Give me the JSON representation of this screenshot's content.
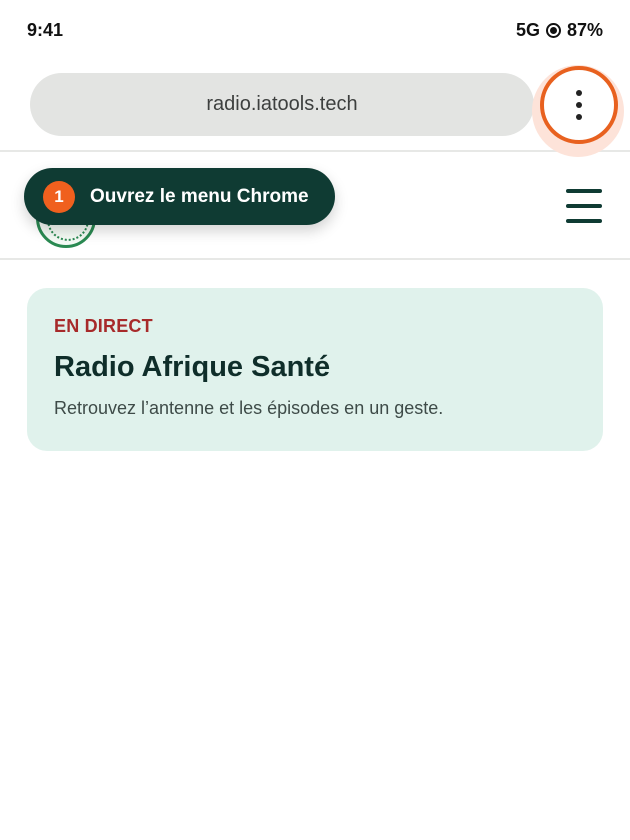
{
  "status_bar": {
    "time": "9:41",
    "network": "5G",
    "battery": "87%"
  },
  "browser": {
    "url": "radio.iatools.tech",
    "menu_icon": "more-vert-icon",
    "highlight_color": "#e8611f"
  },
  "site_header": {
    "logo_icon": "site-logo",
    "menu_icon": "hamburger-icon",
    "accent_color": "#0f3b33"
  },
  "coach_mark": {
    "step": "1",
    "text": "Ouvrez le menu Chrome"
  },
  "live_card": {
    "label": "EN DIRECT",
    "title": "Radio Afrique Santé",
    "description": "Retrouvez l’antenne et les épisodes en un geste."
  }
}
